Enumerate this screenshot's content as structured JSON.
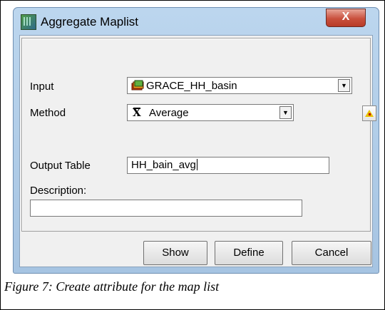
{
  "window": {
    "title": "Aggregate Maplist",
    "close_label": "X"
  },
  "form": {
    "input_label": "Input",
    "input_value": "GRACE_HH_basin",
    "method_label": "Method",
    "method_value": "Average",
    "output_table_label": "Output Table",
    "output_table_value": "HH_bain_avg",
    "description_label": "Description:",
    "description_value": ""
  },
  "buttons": {
    "show": "Show",
    "define": "Define",
    "cancel": "Cancel"
  },
  "caption": "Figure 7: Create attribute for the map list"
}
